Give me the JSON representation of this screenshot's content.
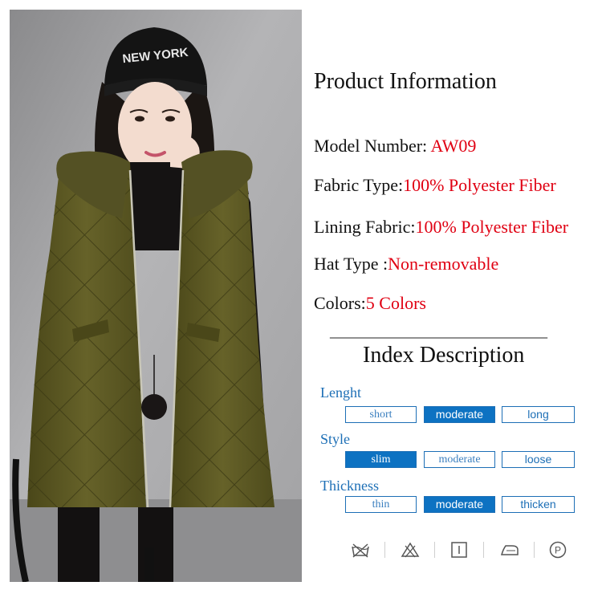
{
  "product_info": {
    "title": "Product Information",
    "rows": [
      {
        "label": "Model Number:  ",
        "value": "AW09"
      },
      {
        "label": "Fabric Type:",
        "value": "100% Polyester Fiber"
      },
      {
        "label": "Lining Fabric:",
        "value": "100% Polyester Fiber"
      },
      {
        "label": "Hat Type :",
        "value": "Non-removable"
      },
      {
        "label": "Colors:",
        "value": "5 Colors"
      }
    ]
  },
  "divider": "______________________________",
  "index": {
    "title": "Index Description",
    "rows": [
      {
        "label": "Lenght",
        "options": [
          "short",
          "moderate",
          "long"
        ],
        "selected": "moderate"
      },
      {
        "label": "Style",
        "options": [
          "slim",
          "moderate",
          "loose"
        ],
        "selected": "slim"
      },
      {
        "label": "Thickness",
        "options": [
          "thin",
          "moderate",
          "thicken"
        ],
        "selected": "moderate"
      }
    ]
  },
  "photo": {
    "hat_text": "NEW YORK"
  },
  "care_icons": [
    "no-wash-icon",
    "no-bleach-icon",
    "drip-dry-icon",
    "iron-icon",
    "dry-clean-p-icon"
  ],
  "colors": {
    "accent_red": "#e00012",
    "accent_blue": "#1d6fb6",
    "selected_blue": "#0d72c2",
    "vest_green": "#5d5a22"
  }
}
